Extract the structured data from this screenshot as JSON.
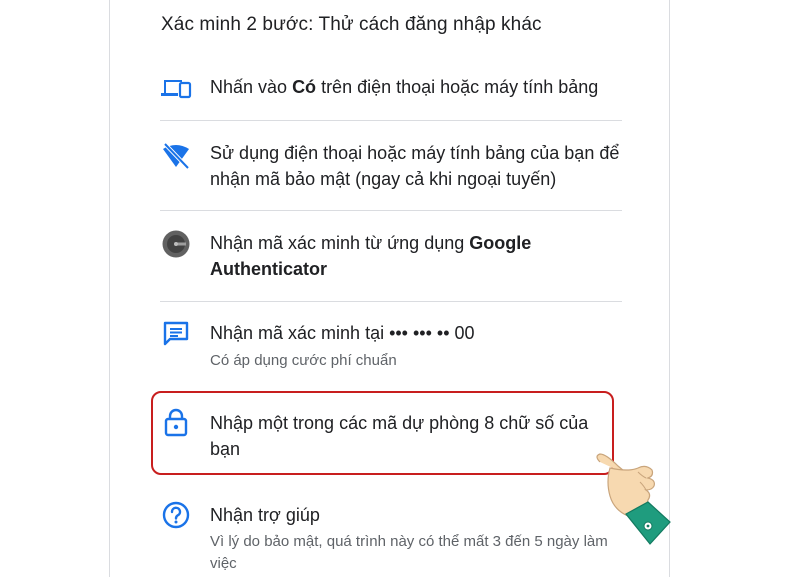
{
  "header": {
    "title": "Xác minh 2 bước: Thử cách đăng nhập khác"
  },
  "options": [
    {
      "icon": "devices-icon",
      "text_before": "Nhấn vào ",
      "text_bold": "Có",
      "text_after": " trên điện thoại hoặc máy tính bảng"
    },
    {
      "icon": "no-signal-phone-icon",
      "text": "Sử dụng điện thoại hoặc máy tính bảng của bạn để nhận mã bảo mật (ngay cả khi ngoại tuyến)"
    },
    {
      "icon": "google-authenticator-icon",
      "text_before": "Nhận mã xác minh từ ứng dụng ",
      "text_bold": "Google Authenticator"
    },
    {
      "icon": "sms-message-icon",
      "text": "Nhận mã xác minh tại ••• ••• •• 00",
      "subtext": "Có áp dụng cước phí chuẩn"
    },
    {
      "icon": "lock-icon",
      "text": "Nhập một trong các mã dự phòng 8 chữ số của bạn",
      "highlighted": true
    },
    {
      "icon": "help-icon",
      "text": "Nhận trợ giúp",
      "subtext": "Vì lý do bảo mật, quá trình này có thể mất 3 đến 5 ngày làm việc"
    }
  ],
  "colors": {
    "icon_blue": "#1a73e8",
    "text": "#202124",
    "subtext": "#5f6368",
    "divider": "#dadce0",
    "highlight": "#c81e1e",
    "hand_skin": "#f7d9b0",
    "hand_sleeve": "#1f9c7e"
  }
}
